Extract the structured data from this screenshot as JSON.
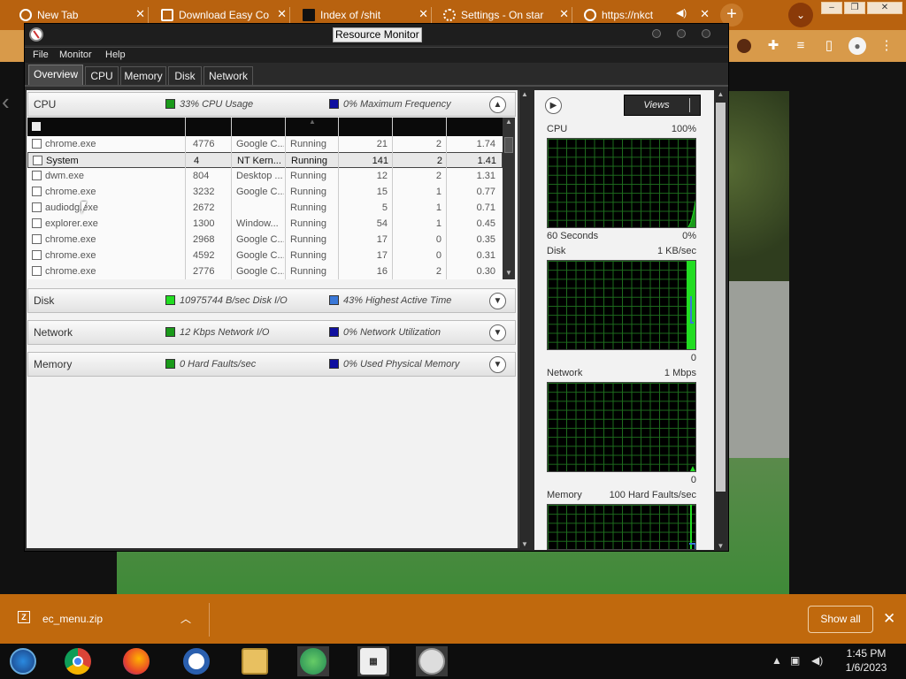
{
  "browser": {
    "tabs": [
      {
        "label": "New Tab",
        "icon": "chrome-icon"
      },
      {
        "label": "Download Easy Co",
        "icon": "download-site-icon"
      },
      {
        "label": "Index of /shit",
        "icon": "folder-icon"
      },
      {
        "label": "Settings - On star",
        "icon": "gear-icon"
      },
      {
        "label": "https://nkct",
        "icon": "globe-icon"
      }
    ],
    "new_tab": "+",
    "close_glyph": "✕"
  },
  "download_bar": {
    "file_name": "ec_menu.zip",
    "show_all": "Show all"
  },
  "taskbar": {
    "apps": [
      "Windows",
      "Google Chrome",
      "Firefox",
      "Opera",
      "File Explorer",
      "Messenger",
      "Calendar",
      "Resource Monitor"
    ],
    "time": "1:45 PM",
    "date": "1/6/2023"
  },
  "resmon": {
    "title": "Resource Monitor",
    "menu": [
      "File",
      "Monitor",
      "Help"
    ],
    "tabs": [
      "Overview",
      "CPU",
      "Memory",
      "Disk",
      "Network"
    ],
    "selected_tab": "Overview",
    "cpu": {
      "title": "CPU",
      "stat1": "33% CPU Usage",
      "stat2": "0% Maximum Frequency",
      "rows": [
        {
          "image": "chrome.exe",
          "pid": "4776",
          "desc": "Google C...",
          "status": "Running",
          "threads": "21",
          "cpu": "2",
          "avg": "1.74"
        },
        {
          "image": "System",
          "pid": "4",
          "desc": "NT Kern...",
          "status": "Running",
          "threads": "141",
          "cpu": "2",
          "avg": "1.41"
        },
        {
          "image": "dwm.exe",
          "pid": "804",
          "desc": "Desktop ...",
          "status": "Running",
          "threads": "12",
          "cpu": "2",
          "avg": "1.31"
        },
        {
          "image": "chrome.exe",
          "pid": "3232",
          "desc": "Google C...",
          "status": "Running",
          "threads": "15",
          "cpu": "1",
          "avg": "0.77"
        },
        {
          "image": "audiodg.exe",
          "pid": "2672",
          "desc": "",
          "status": "Running",
          "threads": "5",
          "cpu": "1",
          "avg": "0.71"
        },
        {
          "image": "explorer.exe",
          "pid": "1300",
          "desc": "Window...",
          "status": "Running",
          "threads": "54",
          "cpu": "1",
          "avg": "0.45"
        },
        {
          "image": "chrome.exe",
          "pid": "2968",
          "desc": "Google C...",
          "status": "Running",
          "threads": "17",
          "cpu": "0",
          "avg": "0.35"
        },
        {
          "image": "chrome.exe",
          "pid": "4592",
          "desc": "Google C...",
          "status": "Running",
          "threads": "17",
          "cpu": "0",
          "avg": "0.31"
        },
        {
          "image": "chrome.exe",
          "pid": "2776",
          "desc": "Google C...",
          "status": "Running",
          "threads": "16",
          "cpu": "2",
          "avg": "0.30"
        }
      ]
    },
    "disk": {
      "title": "Disk",
      "stat1": "10975744 B/sec Disk I/O",
      "stat2": "43% Highest Active Time"
    },
    "network": {
      "title": "Network",
      "stat1": "12 Kbps Network I/O",
      "stat2": "0% Network Utilization"
    },
    "memory": {
      "title": "Memory",
      "stat1": "0 Hard Faults/sec",
      "stat2": "0% Used Physical Memory"
    },
    "views_label": "Views",
    "graphs": [
      {
        "title": "CPU",
        "max": "100%",
        "left_footer": "60 Seconds",
        "right_footer": "0%"
      },
      {
        "title": "Disk",
        "max": "1 KB/sec",
        "left_footer": "",
        "right_footer": "0"
      },
      {
        "title": "Network",
        "max": "1 Mbps",
        "left_footer": "",
        "right_footer": "0"
      },
      {
        "title": "Memory",
        "max": "100 Hard Faults/sec",
        "left_footer": "",
        "right_footer": ""
      }
    ],
    "colors": {
      "usage_green": "#1a9a1a",
      "bright_green": "#22dd22",
      "frequency_blue": "#1010a0",
      "light_blue": "#3a78d8"
    }
  }
}
